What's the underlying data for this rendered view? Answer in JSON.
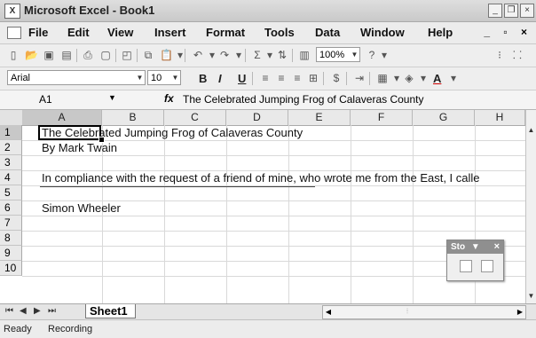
{
  "window": {
    "title": "Microsoft Excel - Book1",
    "app_icon": "excel-icon"
  },
  "menu": {
    "items": [
      "File",
      "Edit",
      "View",
      "Insert",
      "Format",
      "Tools",
      "Data",
      "Window",
      "Help"
    ],
    "underlined": [
      "F",
      "E",
      "V",
      "I",
      "o",
      "T",
      "D",
      "W",
      "H"
    ],
    "right_controls": "_ ð ×"
  },
  "toolbar": {
    "zoom": "100%"
  },
  "format_toolbar": {
    "font_name": "Arial",
    "font_size": "10"
  },
  "formula_bar": {
    "name_box": "A1",
    "fx_label": "fx",
    "formula": "The Celebrated Jumping Frog of Calaveras County"
  },
  "grid": {
    "columns": [
      "A",
      "B",
      "C",
      "D",
      "E",
      "F",
      "G",
      "H"
    ],
    "rows": [
      "1",
      "2",
      "3",
      "4",
      "5",
      "6",
      "7",
      "8",
      "9",
      "10"
    ],
    "cells": {
      "A1": "The Celebrated Jumping Frog of Calaveras County",
      "A2": "By Mark Twain",
      "A4": "In compliance with the request of a friend of mine, who wrote me from the East, I calle",
      "A6": "Simon Wheeler"
    }
  },
  "sheets": {
    "active": "Sheet1"
  },
  "status": {
    "ready": "Ready",
    "recording": "Recording"
  },
  "stop_toolbar": {
    "title": "Sto",
    "dropdown": "▼",
    "close": "×"
  }
}
